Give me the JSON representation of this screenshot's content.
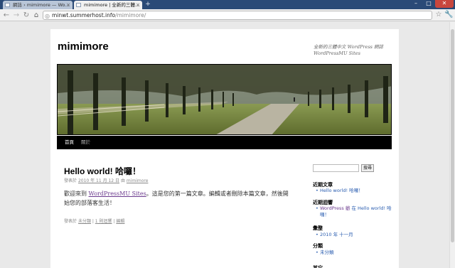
{
  "browser": {
    "tabs": [
      {
        "label": "網誌 › mimimore — Wo..."
      },
      {
        "label": "mimimore | 全新的三體..."
      }
    ],
    "new_tab": "+",
    "url_host": "minwt.summerhost.info",
    "url_path": "/mimimore/",
    "buttons": {
      "back": "←",
      "forward": "→",
      "reload": "↻",
      "home": "⌂",
      "star": "☆",
      "menu": "🔧"
    },
    "window": {
      "minimize": "–",
      "maximize": "□",
      "close": "✕"
    }
  },
  "site": {
    "title": "mimimore",
    "description": "全新的三體中文 WordPress 網誌 WordPressMU Sites",
    "menu": {
      "home": "首頁",
      "about": "關於"
    }
  },
  "post": {
    "title": "Hello world! 哈囉！",
    "meta_prefix": "發表於",
    "date": "2010 年 11 月 12 日",
    "meta_by": "由",
    "author": "mimimore",
    "body_prefix": "歡迎來到 ",
    "body_link": "WordPressMU Sites",
    "body_suffix": "。這是您的第一篇文章。編輯或者刪除本篇文章，然後開始您的部落客生活！",
    "util_prefix": "發表於",
    "category": "未分類",
    "comments": "1 則迴響",
    "edit": "編輯"
  },
  "sidebar": {
    "search_button": "搜尋",
    "recent_posts_title": "近期文章",
    "recent_posts": [
      "Hello world! 哈囉！"
    ],
    "recent_comments_title": "近期迴響",
    "recent_comment_author": "WordPress 爺",
    "recent_comment_text": " 在 Hello world! 哈囉！",
    "archives_title": "彙整",
    "archives": [
      "2010 年 十一月"
    ],
    "categories_title": "分類",
    "categories": [
      "未分類"
    ],
    "other_title": "其它"
  }
}
